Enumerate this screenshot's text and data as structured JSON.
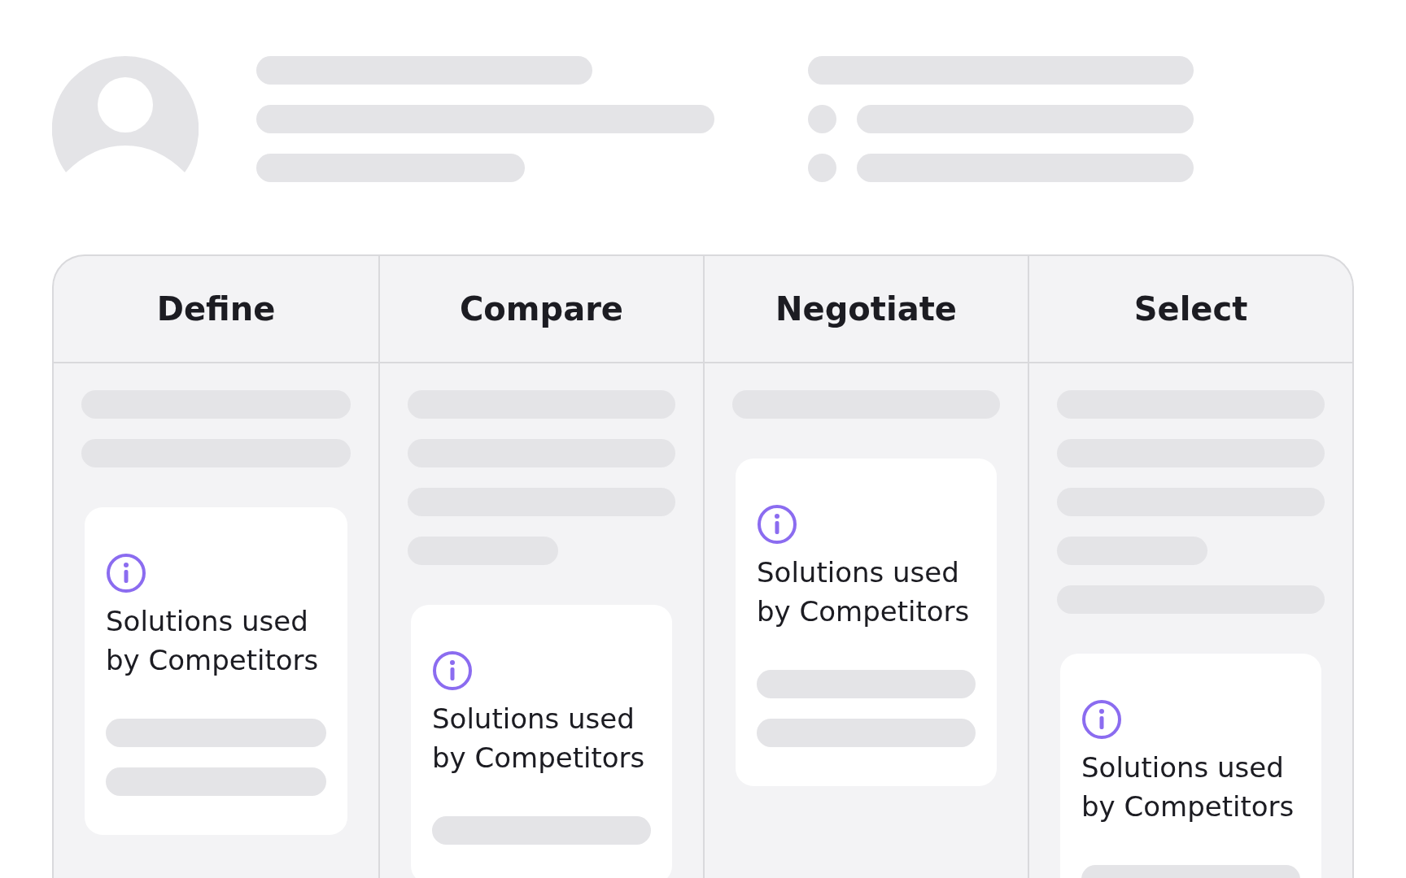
{
  "columns": [
    {
      "title": "Define",
      "items": [
        {
          "kind": "bar"
        },
        {
          "kind": "bar"
        },
        {
          "kind": "card",
          "text": "Solutions used by Competitors",
          "lines": [
            {
              "kind": "bar"
            },
            {
              "kind": "bar"
            }
          ]
        }
      ]
    },
    {
      "title": "Compare",
      "items": [
        {
          "kind": "bar"
        },
        {
          "kind": "bar"
        },
        {
          "kind": "bar"
        },
        {
          "kind": "short"
        },
        {
          "kind": "card",
          "text": "Solutions used by Competitors",
          "lines": [
            {
              "kind": "bar"
            }
          ]
        }
      ]
    },
    {
      "title": "Negotiate",
      "items": [
        {
          "kind": "bar"
        },
        {
          "kind": "card",
          "text": "Solutions used by Competitors",
          "lines": [
            {
              "kind": "bar"
            },
            {
              "kind": "bar"
            }
          ]
        }
      ]
    },
    {
      "title": "Select",
      "items": [
        {
          "kind": "bar"
        },
        {
          "kind": "bar"
        },
        {
          "kind": "bar"
        },
        {
          "kind": "short"
        },
        {
          "kind": "bar"
        },
        {
          "kind": "card",
          "text": "Solutions used by Competitors",
          "lines": [
            {
              "kind": "bar"
            }
          ]
        }
      ]
    }
  ]
}
